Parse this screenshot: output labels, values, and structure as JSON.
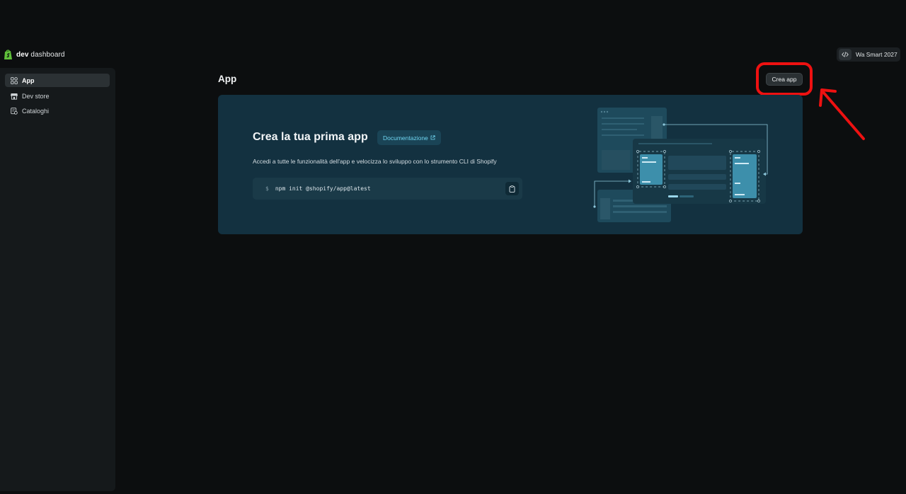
{
  "brand": {
    "bold": "dev",
    "rest": " dashboard"
  },
  "account": {
    "name": "Wa Smart 2027"
  },
  "sidebar": {
    "items": [
      {
        "label": "App",
        "icon": "apps-icon",
        "active": true
      },
      {
        "label": "Dev store",
        "icon": "store-icon",
        "active": false
      },
      {
        "label": "Cataloghi",
        "icon": "catalog-icon",
        "active": false
      }
    ]
  },
  "header": {
    "title": "App",
    "create_label": "Crea app"
  },
  "hero": {
    "title": "Crea la tua prima app",
    "docs_label": "Documentazione",
    "description": "Accedi a tutte le funzionalità dell'app e velocizza lo sviluppo con lo strumento CLI di Shopify",
    "command_prompt": "$",
    "command": "npm init @shopify/app@latest"
  },
  "colors": {
    "background": "#0c0e0f",
    "sidebar": "#15191b",
    "hero": "#133140",
    "link": "#6fd6f2",
    "annotation": "#ee1111",
    "brand_green": "#5fbf3a"
  }
}
